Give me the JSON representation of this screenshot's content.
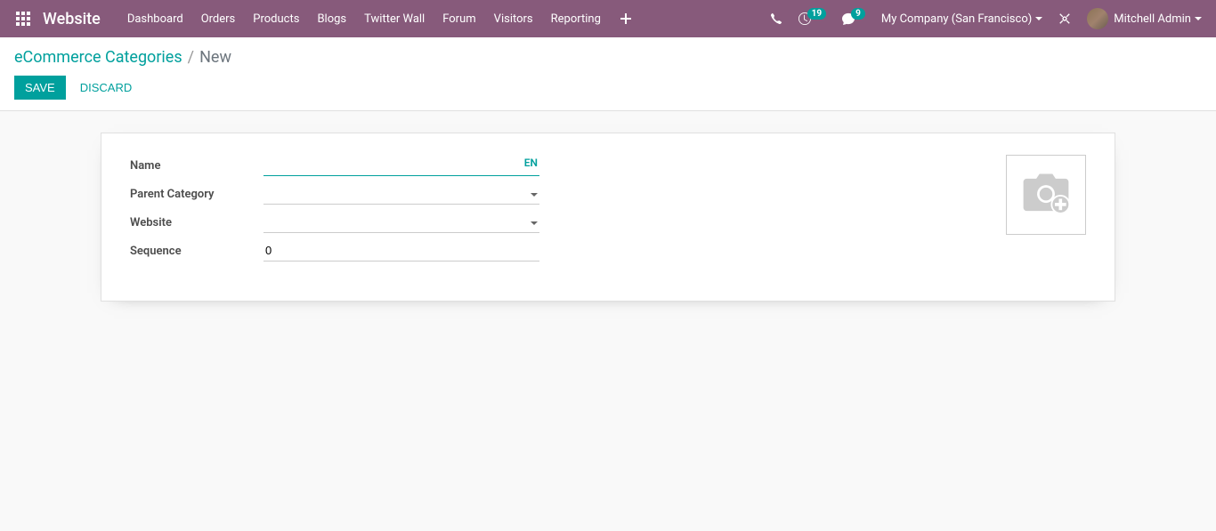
{
  "navbar": {
    "brand": "Website",
    "menu": [
      "Dashboard",
      "Orders",
      "Products",
      "Blogs",
      "Twitter Wall",
      "Forum",
      "Visitors",
      "Reporting"
    ],
    "activities_count": "19",
    "messages_count": "9",
    "company": "My Company (San Francisco)",
    "user": "Mitchell Admin"
  },
  "breadcrumb": {
    "parent": "eCommerce Categories",
    "current": "New"
  },
  "buttons": {
    "save": "Save",
    "discard": "Discard"
  },
  "form": {
    "name_label": "Name",
    "name_value": "",
    "lang_tag": "EN",
    "parent_label": "Parent Category",
    "parent_value": "",
    "website_label": "Website",
    "website_value": "",
    "sequence_label": "Sequence",
    "sequence_value": "0"
  }
}
